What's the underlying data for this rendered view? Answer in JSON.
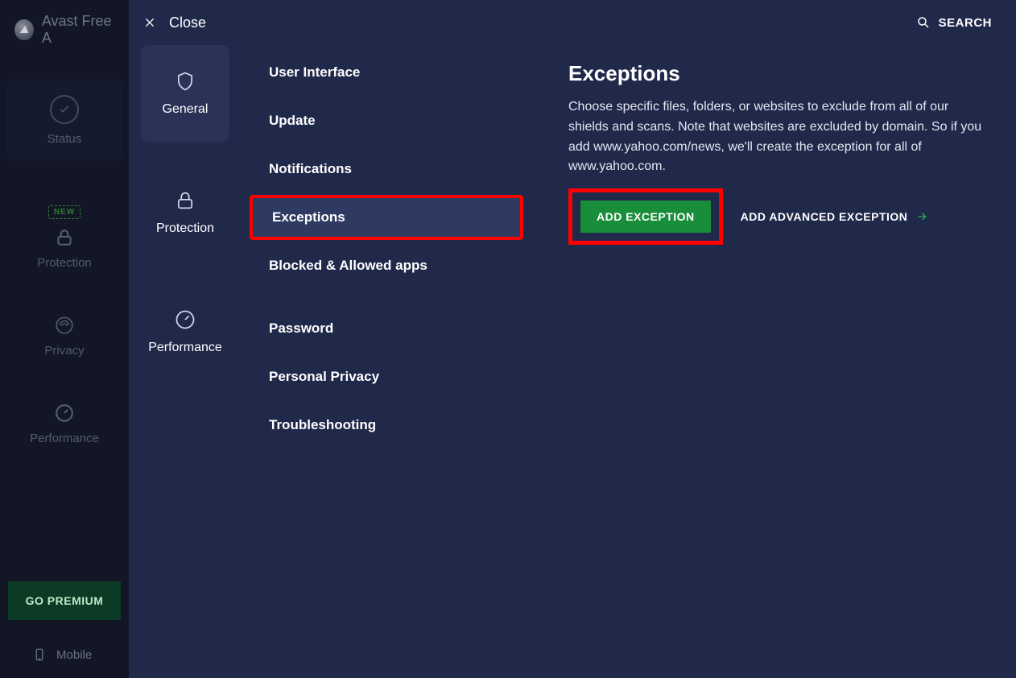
{
  "app": {
    "title": "Avast Free A"
  },
  "leftnav": {
    "status": "Status",
    "protection": "Protection",
    "privacy": "Privacy",
    "performance": "Performance",
    "new_badge": "NEW",
    "go_premium": "GO PREMIUM",
    "mobile": "Mobile"
  },
  "settings": {
    "close": "Close",
    "search": "SEARCH",
    "categories": {
      "general": "General",
      "protection": "Protection",
      "performance": "Performance"
    },
    "submenu": {
      "ui": "User Interface",
      "update": "Update",
      "notifications": "Notifications",
      "exceptions": "Exceptions",
      "blocked": "Blocked & Allowed apps",
      "password": "Password",
      "privacy": "Personal Privacy",
      "troubleshoot": "Troubleshooting"
    }
  },
  "main": {
    "title": "Exceptions",
    "description": "Choose specific files, folders, or websites to exclude from all of our shields and scans. Note that websites are excluded by domain. So if you add www.yahoo.com/news, we'll create the exception for all of www.yahoo.com.",
    "add_exception": "ADD EXCEPTION",
    "add_advanced": "ADD ADVANCED EXCEPTION"
  }
}
